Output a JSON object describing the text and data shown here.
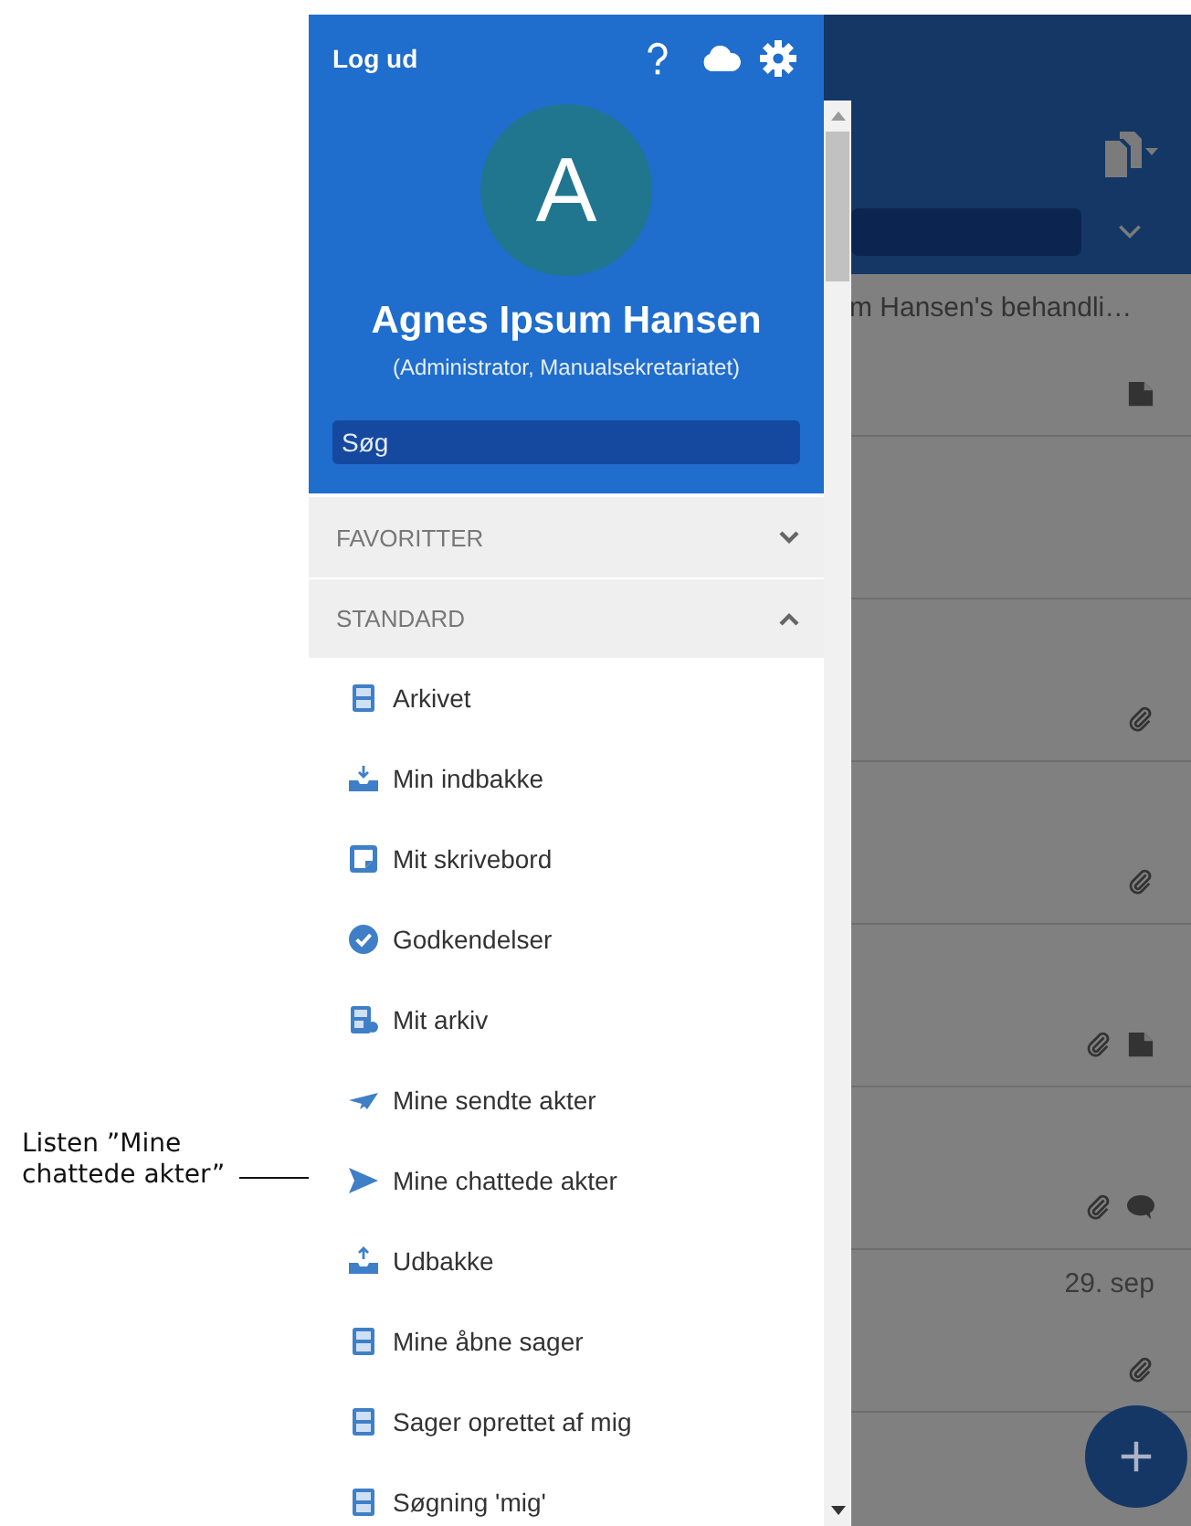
{
  "annotation": {
    "text": "Listen ”Mine chattede akter”"
  },
  "background_app": {
    "rows": [
      {
        "title": "m Hansen's behandli…",
        "document": true
      },
      {},
      {
        "attachment": true
      },
      {
        "attachment": true
      },
      {
        "attachment": true,
        "document": true
      },
      {
        "attachment": true,
        "comment": true
      },
      {
        "date": "29. sep",
        "attachment": true
      },
      {}
    ]
  },
  "drawer": {
    "logout": "Log ud",
    "avatar_letter": "A",
    "user_name": "Agnes Ipsum Hansen",
    "user_role": "(Administrator, Manualsekretariatet)",
    "search": {
      "placeholder": "Søg"
    },
    "sections": [
      {
        "title": "FAVORITTER",
        "expanded": false
      },
      {
        "title": "STANDARD",
        "expanded": true,
        "items": [
          {
            "label": "Arkivet",
            "kind": "cabinet"
          },
          {
            "label": "Min indbakke",
            "kind": "inbox"
          },
          {
            "label": "Mit skrivebord",
            "kind": "desk"
          },
          {
            "label": "Godkendelser",
            "kind": "check"
          },
          {
            "label": "Mit arkiv",
            "kind": "cabinet-user"
          },
          {
            "label": "Mine sendte akter",
            "kind": "plane"
          },
          {
            "label": "Mine chattede akter",
            "kind": "send"
          },
          {
            "label": "Udbakke",
            "kind": "outbox"
          },
          {
            "label": "Mine åbne sager",
            "kind": "cabinet"
          },
          {
            "label": "Sager oprettet af mig",
            "kind": "cabinet"
          },
          {
            "label": "Søgning 'mig'",
            "kind": "cabinet"
          }
        ]
      }
    ]
  }
}
